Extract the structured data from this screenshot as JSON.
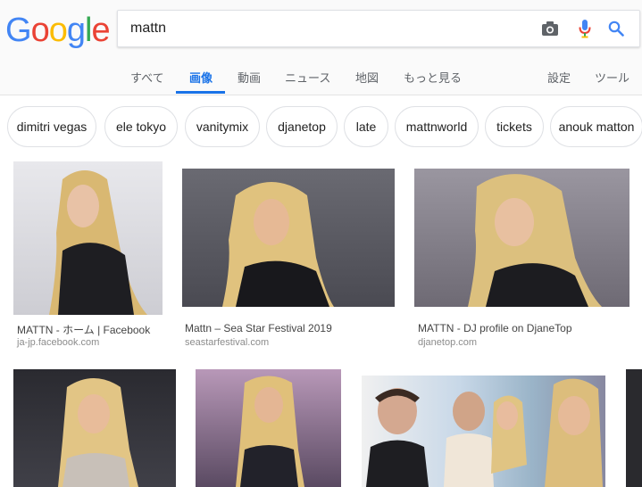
{
  "logo": {
    "letters": [
      "G",
      "o",
      "o",
      "g",
      "l",
      "e"
    ],
    "colors": [
      "#4285F4",
      "#EA4335",
      "#FBBC05",
      "#4285F4",
      "#34A853",
      "#EA4335"
    ]
  },
  "search": {
    "query": "mattn"
  },
  "tabs": [
    {
      "label": "すべて"
    },
    {
      "label": "画像",
      "active": true
    },
    {
      "label": "動画"
    },
    {
      "label": "ニュース"
    },
    {
      "label": "地図"
    },
    {
      "label": "もっと見る"
    }
  ],
  "settings_label": "設定",
  "tools_label": "ツール",
  "chips": [
    "dimitri vegas",
    "ele tokyo",
    "vanitymix",
    "djanetop",
    "late",
    "mattnworld",
    "tickets",
    "anouk matton"
  ],
  "results": [
    {
      "title": "MATTN - ホーム | Facebook",
      "domain": "ja-jp.facebook.com"
    },
    {
      "title": "Mattn – Sea Star Festival 2019",
      "domain": "seastarfestival.com"
    },
    {
      "title": "MATTN - DJ profile on DjaneTop",
      "domain": "djanetop.com"
    }
  ],
  "colors": {
    "accent": "#1a73e8",
    "tab_text": "#5f6368"
  }
}
